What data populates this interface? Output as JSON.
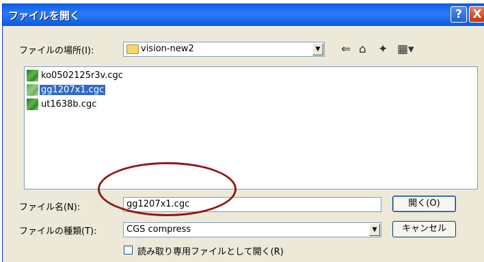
{
  "dialog": {
    "title": "ファイルを開く",
    "help_glyph": "?",
    "close_glyph": "X"
  },
  "lookin": {
    "label": "ファイルの場所(I):",
    "value": "vision-new2"
  },
  "toolbar": {
    "back_glyph": "⇐",
    "up_glyph": "⌂",
    "newfolder_glyph": "✦",
    "view_glyph": "▦▾"
  },
  "files": [
    {
      "name": "ko0502125r3v.cgc",
      "selected": false
    },
    {
      "name": "gg1207x1.cgc",
      "selected": true
    },
    {
      "name": "ut1638b.cgc",
      "selected": false
    }
  ],
  "filename": {
    "label": "ファイル名(N):",
    "value": "gg1207x1.cgc"
  },
  "filetype": {
    "label": "ファイルの種類(T):",
    "value": "CGS compress"
  },
  "buttons": {
    "open": "開く(O)",
    "cancel": "キャンセル"
  },
  "readonly": {
    "label": "読み取り専用ファイルとして開く(R)",
    "checked": false
  },
  "colors": {
    "title_bar": "#0a5be6",
    "selection": "#316ac5",
    "annotation": "#8b1a17"
  }
}
